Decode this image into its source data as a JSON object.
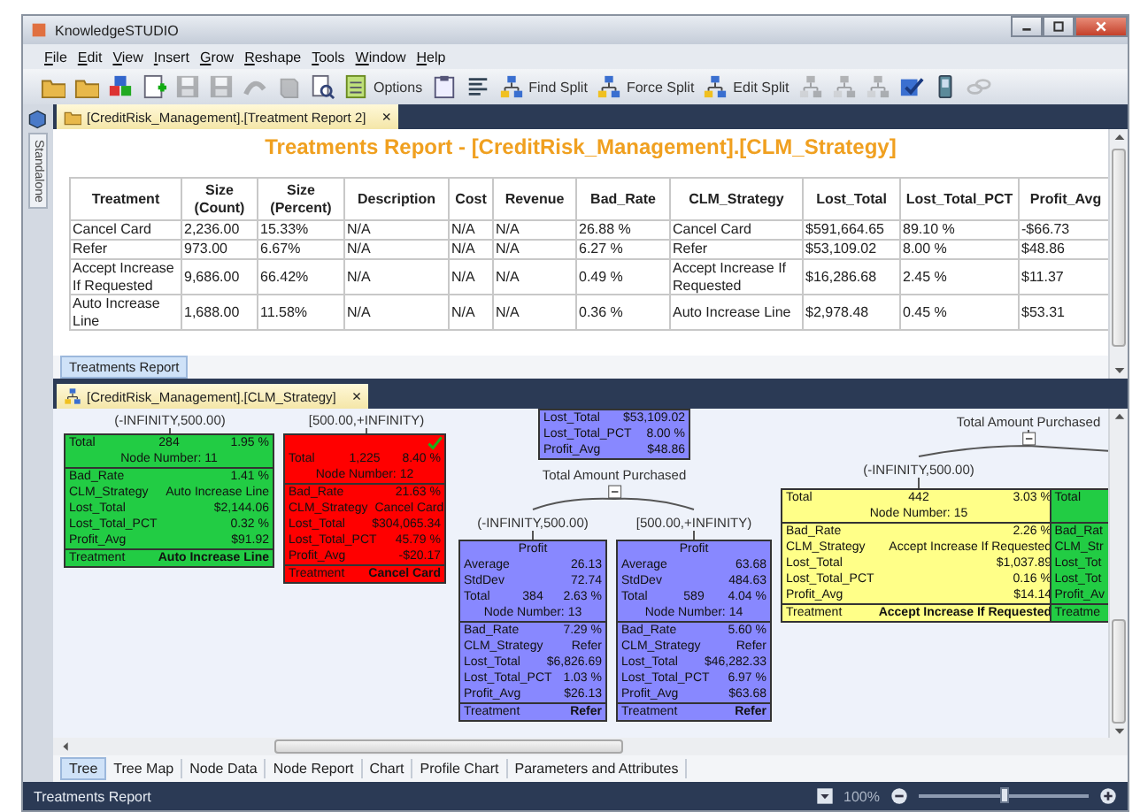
{
  "window": {
    "title": "KnowledgeSTUDIO"
  },
  "menu": [
    "File",
    "Edit",
    "View",
    "Insert",
    "Grow",
    "Reshape",
    "Tools",
    "Window",
    "Help"
  ],
  "toolbar": [
    {
      "kind": "icon",
      "disabled": false
    },
    {
      "kind": "icon",
      "disabled": false
    },
    {
      "kind": "icon",
      "disabled": false
    },
    {
      "kind": "icon",
      "disabled": false
    },
    {
      "kind": "icon",
      "disabled": true
    },
    {
      "kind": "icon",
      "disabled": true
    },
    {
      "kind": "icon",
      "disabled": true
    },
    {
      "kind": "icon",
      "disabled": true
    },
    {
      "kind": "icon",
      "disabled": false
    },
    {
      "kind": "button",
      "label": "Options",
      "disabled": false
    },
    {
      "kind": "icon",
      "disabled": false
    },
    {
      "kind": "icon",
      "disabled": false
    },
    {
      "kind": "button",
      "label": "Find Split",
      "disabled": false
    },
    {
      "kind": "button",
      "label": "Force Split",
      "disabled": false
    },
    {
      "kind": "button",
      "label": "Edit Split",
      "disabled": false
    },
    {
      "kind": "icon",
      "disabled": true
    },
    {
      "kind": "icon",
      "disabled": true
    },
    {
      "kind": "icon",
      "disabled": true
    },
    {
      "kind": "icon",
      "disabled": false
    },
    {
      "kind": "icon",
      "disabled": false
    },
    {
      "kind": "icon",
      "disabled": true
    }
  ],
  "side_tabs": [
    {
      "label": "Standalone"
    }
  ],
  "document_tab": {
    "label": "[CreditRisk_Management].[Treatment Report 2]",
    "close": "×"
  },
  "report": {
    "title": "Treatments Report - [CreditRisk_Management].[CLM_Strategy]",
    "table": {
      "columns": [
        "Treatment",
        "Size (Count)",
        "Size (Percent)",
        "Description",
        "Cost",
        "Revenue",
        "Bad_Rate",
        "CLM_Strategy",
        "Lost_Total",
        "Lost_Total_PCT",
        "Profit_Avg"
      ],
      "rows": [
        [
          "Cancel Card",
          "2,236.00",
          "15.33%",
          "N/A",
          "N/A",
          "N/A",
          "26.88 %",
          "Cancel Card",
          "$591,664.65",
          "89.10 %",
          "-$66.73"
        ],
        [
          "Refer",
          "973.00",
          "6.67%",
          "N/A",
          "N/A",
          "N/A",
          "6.27 %",
          "Refer",
          "$53,109.02",
          "8.00 %",
          "$48.86"
        ],
        [
          "Accept Increase If Requested",
          "9,686.00",
          "66.42%",
          "N/A",
          "N/A",
          "N/A",
          "0.49 %",
          "Accept Increase If Requested",
          "$16,286.68",
          "2.45 %",
          "$11.37"
        ],
        [
          "Auto Increase Line",
          "1,688.00",
          "11.58%",
          "N/A",
          "N/A",
          "N/A",
          "0.36 %",
          "Auto Increase Line",
          "$2,978.48",
          "0.45 %",
          "$53.31"
        ]
      ]
    },
    "tabs": [
      {
        "label": "Treatments Report",
        "selected": true
      }
    ]
  },
  "tree_view": {
    "tab": {
      "label": "[CreditRisk_Management].[CLM_Strategy]",
      "close": "×"
    },
    "items": [
      {
        "kind": "range",
        "text": "(-INFINITY,500.00)"
      },
      {
        "kind": "range",
        "text": "[500.00,+INFINITY)"
      },
      {
        "kind": "node",
        "color": "#22cc44",
        "checked": false,
        "sections": [
          [
            {
              "kind": "triple",
              "label": "Total",
              "count": "284",
              "percent": "1.95 %"
            },
            {
              "kind": "center",
              "text": "Node Number: 11"
            }
          ],
          [
            {
              "kind": "pair",
              "label": "Bad_Rate",
              "value": "1.41 %"
            },
            {
              "kind": "pair",
              "label": "CLM_Strategy",
              "value": "Auto Increase Line"
            },
            {
              "kind": "pair",
              "label": "Lost_Total",
              "value": "$2,144.06"
            },
            {
              "kind": "pair",
              "label": "Lost_Total_PCT",
              "value": "0.32 %"
            },
            {
              "kind": "pair",
              "label": "Profit_Avg",
              "value": "$91.92"
            }
          ],
          [
            {
              "kind": "result",
              "label": "Treatment",
              "value": "Auto Increase Line"
            }
          ]
        ]
      },
      {
        "kind": "node",
        "color": "#ff0000",
        "checked": true,
        "sections": [
          [
            {
              "kind": "triple",
              "label": "Total",
              "count": "1,225",
              "percent": "8.40 %"
            },
            {
              "kind": "center",
              "text": "Node Number: 12"
            }
          ],
          [
            {
              "kind": "pair",
              "label": "Bad_Rate",
              "value": "21.63 %"
            },
            {
              "kind": "pair",
              "label": "CLM_Strategy",
              "value": "Cancel Card"
            },
            {
              "kind": "pair",
              "label": "Lost_Total",
              "value": "$304,065.34"
            },
            {
              "kind": "pair",
              "label": "Lost_Total_PCT",
              "value": "45.79 %"
            },
            {
              "kind": "pair",
              "label": "Profit_Avg",
              "value": "-$20.17"
            }
          ],
          [
            {
              "kind": "result",
              "label": "Treatment",
              "value": "Cancel Card"
            }
          ]
        ]
      },
      {
        "kind": "node",
        "color": "#8888ff",
        "checked": false,
        "sections": [
          [
            {
              "kind": "pair",
              "label": "Lost_Total",
              "value": "$53,109.02"
            },
            {
              "kind": "pair",
              "label": "Lost_Total_PCT",
              "value": "8.00 %"
            },
            {
              "kind": "pair",
              "label": "Profit_Avg",
              "value": "$48.86"
            }
          ]
        ]
      },
      {
        "kind": "split",
        "text": "Total Amount Purchased"
      },
      {
        "kind": "range",
        "text": "(-INFINITY,500.00)"
      },
      {
        "kind": "range",
        "text": "[500.00,+INFINITY)"
      },
      {
        "kind": "node",
        "color": "#8888ff",
        "checked": false,
        "sections": [
          [
            {
              "kind": "center",
              "text": "Profit"
            },
            {
              "kind": "pair",
              "label": "Average",
              "value": "26.13"
            },
            {
              "kind": "pair",
              "label": "StdDev",
              "value": "72.74"
            },
            {
              "kind": "triple",
              "label": "Total",
              "count": "384",
              "percent": "2.63 %"
            },
            {
              "kind": "center",
              "text": "Node Number: 13"
            }
          ],
          [
            {
              "kind": "pair",
              "label": "Bad_Rate",
              "value": "7.29 %"
            },
            {
              "kind": "pair",
              "label": "CLM_Strategy",
              "value": "Refer"
            },
            {
              "kind": "pair",
              "label": "Lost_Total",
              "value": "$6,826.69"
            },
            {
              "kind": "pair",
              "label": "Lost_Total_PCT",
              "value": "1.03 %"
            },
            {
              "kind": "pair",
              "label": "Profit_Avg",
              "value": "$26.13"
            }
          ],
          [
            {
              "kind": "result",
              "label": "Treatment",
              "value": "Refer"
            }
          ]
        ]
      },
      {
        "kind": "node",
        "color": "#8888ff",
        "checked": false,
        "sections": [
          [
            {
              "kind": "center",
              "text": "Profit"
            },
            {
              "kind": "pair",
              "label": "Average",
              "value": "63.68"
            },
            {
              "kind": "pair",
              "label": "StdDev",
              "value": "484.63"
            },
            {
              "kind": "triple",
              "label": "Total",
              "count": "589",
              "percent": "4.04 %"
            },
            {
              "kind": "center",
              "text": "Node Number: 14"
            }
          ],
          [
            {
              "kind": "pair",
              "label": "Bad_Rate",
              "value": "5.60 %"
            },
            {
              "kind": "pair",
              "label": "CLM_Strategy",
              "value": "Refer"
            },
            {
              "kind": "pair",
              "label": "Lost_Total",
              "value": "$46,282.33"
            },
            {
              "kind": "pair",
              "label": "Lost_Total_PCT",
              "value": "6.97 %"
            },
            {
              "kind": "pair",
              "label": "Profit_Avg",
              "value": "$63.68"
            }
          ],
          [
            {
              "kind": "result",
              "label": "Treatment",
              "value": "Refer"
            }
          ]
        ]
      },
      {
        "kind": "split",
        "text": "Total Amount Purchased"
      },
      {
        "kind": "range",
        "text": "(-INFINITY,500.00)"
      },
      {
        "kind": "node",
        "color": "#ffff88",
        "checked": false,
        "sections": [
          [
            {
              "kind": "triple",
              "label": "Total",
              "count": "442",
              "percent": "3.03 %"
            },
            {
              "kind": "center",
              "text": "Node Number: 15"
            }
          ],
          [
            {
              "kind": "pair",
              "label": "Bad_Rate",
              "value": "2.26 %"
            },
            {
              "kind": "pair",
              "label": "CLM_Strategy",
              "value": "Accept Increase If Requested"
            },
            {
              "kind": "pair",
              "label": "Lost_Total",
              "value": "$1,037.89"
            },
            {
              "kind": "pair",
              "label": "Lost_Total_PCT",
              "value": "0.16 %"
            },
            {
              "kind": "pair",
              "label": "Profit_Avg",
              "value": "$14.14"
            }
          ],
          [
            {
              "kind": "result",
              "label": "Treatment",
              "value": "Accept Increase If Requested"
            }
          ]
        ]
      },
      {
        "kind": "node",
        "color": "#22cc44",
        "checked": false,
        "sections": [
          [
            {
              "kind": "stub",
              "label": "Total"
            },
            {
              "kind": "blank"
            }
          ],
          [
            {
              "kind": "stub",
              "label": "Bad_Rat"
            },
            {
              "kind": "stub",
              "label": "CLM_Str"
            },
            {
              "kind": "stub",
              "label": "Lost_Tot"
            },
            {
              "kind": "stub",
              "label": "Lost_Tot"
            },
            {
              "kind": "stub",
              "label": "Profit_Av"
            }
          ],
          [
            {
              "kind": "stub",
              "label": "Treatme"
            }
          ]
        ]
      }
    ],
    "tabs": [
      {
        "label": "Tree",
        "selected": true
      },
      {
        "label": "Tree Map",
        "selected": false
      },
      {
        "label": "Node Data",
        "selected": false
      },
      {
        "label": "Node Report",
        "selected": false
      },
      {
        "label": "Chart",
        "selected": false
      },
      {
        "label": "Profile Chart",
        "selected": false
      },
      {
        "label": "Parameters and Attributes",
        "selected": false
      }
    ]
  },
  "status_bar": {
    "text": "Treatments Report",
    "zoom": "100%",
    "zoom_slider": {
      "level": 0.5
    }
  }
}
